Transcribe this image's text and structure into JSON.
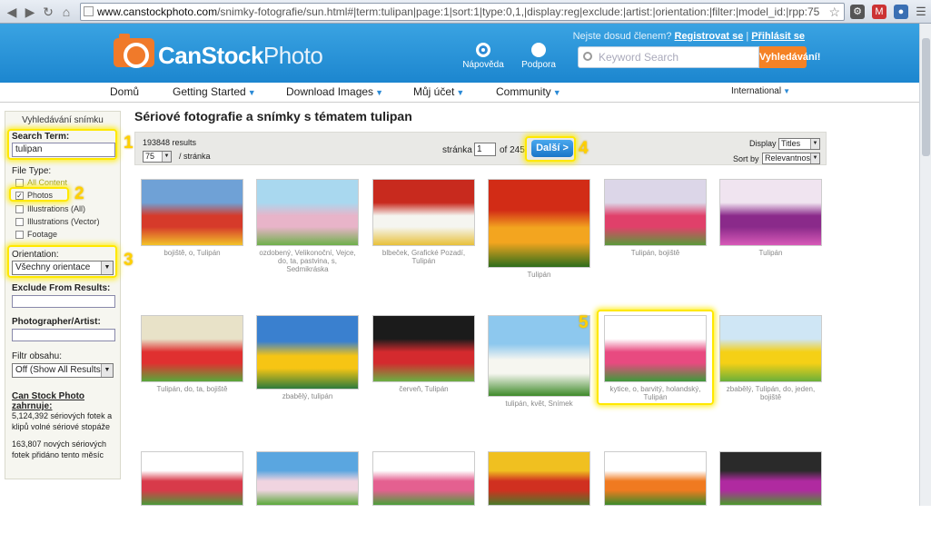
{
  "browser": {
    "url_domain": "www.canstockphoto.com",
    "url_path": "/snimky-fotografie/sun.html#|term:tulipan|page:1|sort:1|type:0,1,|display:reg|exclude:|artist:|orientation:|filter:|model_id:|rpp:75"
  },
  "header": {
    "logo_bold": "CanStock",
    "logo_light": "Photo",
    "help_label": "Nápověda",
    "support_label": "Podpora",
    "not_member_text": "Nejste dosud členem?",
    "register_link": "Registrovat se",
    "separator": "|",
    "login_link": "Přihlásit se",
    "search_placeholder": "Keyword Search",
    "search_button": "Vyhledávání!"
  },
  "nav": {
    "items": [
      "Domů",
      "Getting Started",
      "Download Images",
      "Můj účet",
      "Community"
    ],
    "international": "International"
  },
  "sidebar": {
    "title": "Vyhledávání snímku",
    "search_term_label": "Search Term:",
    "search_term_value": "tulipan",
    "file_type_label": "File Type:",
    "file_types": [
      {
        "label": "All Content",
        "checked": false
      },
      {
        "label": "Photos",
        "checked": true
      },
      {
        "label": "Illustrations (All)",
        "checked": false
      },
      {
        "label": "Illustrations (Vector)",
        "checked": false
      },
      {
        "label": "Footage",
        "checked": false
      }
    ],
    "orientation_label": "Orientation:",
    "orientation_value": "Všechny orientace",
    "exclude_label": "Exclude From Results:",
    "photographer_label": "Photographer/Artist:",
    "filter_label": "Filtr obsahu:",
    "filter_value": "Off (Show All Results)",
    "includes_heading": "Can Stock Photo zahrnuje:",
    "stat1": "5,124,392 sériových fotek a klipů volné sériové stopáže",
    "stat2": "163,807 nových sériových fotek přidáno tento měsíc"
  },
  "main": {
    "title": "Sériové fotografie a snímky s tématem tulipan",
    "results_count": "193848 results",
    "per_page_value": "75",
    "per_page_label": "/ stránka",
    "page_label": "stránka",
    "page_value": "1",
    "page_of": "of 245",
    "next_button": "Další >",
    "display_label": "Display",
    "display_value": "Titles",
    "sort_label": "Sort by",
    "sort_value": "Relevantnost"
  },
  "annotations": [
    "1",
    "2",
    "3",
    "4",
    "5"
  ],
  "thumbnails": [
    {
      "caption": "bojiště, o, Tulipán",
      "colors": [
        "#6fa1d6",
        "#d63a2a",
        "#f2c32a"
      ]
    },
    {
      "caption": "ozdobený, Velikonoční, Vejce, do, ta, pastvina, s, Sedmikráska",
      "colors": [
        "#a9d8ef",
        "#e8b4c9",
        "#6eb04a"
      ]
    },
    {
      "caption": "blbeček, Grafické Pozadí, Tulipán",
      "colors": [
        "#c82a1e",
        "#f5f5f0",
        "#e8c03a"
      ]
    },
    {
      "caption": "Tulipán",
      "colors": [
        "#d22c16",
        "#f3a51f",
        "#2d6d1b"
      ]
    },
    {
      "caption": "Tulipán, bojiště",
      "colors": [
        "#dcd6e8",
        "#e0406a",
        "#5a9a3a"
      ]
    },
    {
      "caption": "Tulipán",
      "colors": [
        "#f0e4f0",
        "#8a2a8a",
        "#d85ab8"
      ]
    },
    {
      "caption": "Tulipán, do, ta, bojiště",
      "colors": [
        "#e8e2c8",
        "#e03030",
        "#58a83a"
      ]
    },
    {
      "caption": "zbabělý, tulipán",
      "colors": [
        "#3a80cf",
        "#f6c514",
        "#2d7a3c"
      ]
    },
    {
      "caption": "červeň, Tulipán",
      "colors": [
        "#1b1b1b",
        "#d42a2e",
        "#6ab042"
      ]
    },
    {
      "caption": "tulipán, květ, Snímek",
      "colors": [
        "#8dc8ee",
        "#f6f6f0",
        "#3e8a2a"
      ]
    },
    {
      "caption": "kytice, o, barvitý, holandský, Tulipán",
      "colors": [
        "#ffffff",
        "#e84a80",
        "#3e9a3a"
      ]
    },
    {
      "caption": "zbabělý, Tulipán, do, jeden, bojiště",
      "colors": [
        "#cfe6f5",
        "#f5d016",
        "#6ab03a"
      ]
    },
    {
      "caption": "",
      "colors": [
        "#ffffff",
        "#d83a4a",
        "#4a9a3a"
      ]
    },
    {
      "caption": "",
      "colors": [
        "#5aa6e0",
        "#f0d4e0",
        "#5aa83a"
      ]
    },
    {
      "caption": "",
      "colors": [
        "#ffffff",
        "#e46090",
        "#4aa03a"
      ]
    },
    {
      "caption": "",
      "colors": [
        "#f0c020",
        "#d03020",
        "#4a7a2a"
      ]
    },
    {
      "caption": "",
      "colors": [
        "#ffffff",
        "#f07a20",
        "#3a8a2a"
      ]
    },
    {
      "caption": "",
      "colors": [
        "#2a2a2a",
        "#b02aa0",
        "#4a9a2a"
      ]
    }
  ]
}
